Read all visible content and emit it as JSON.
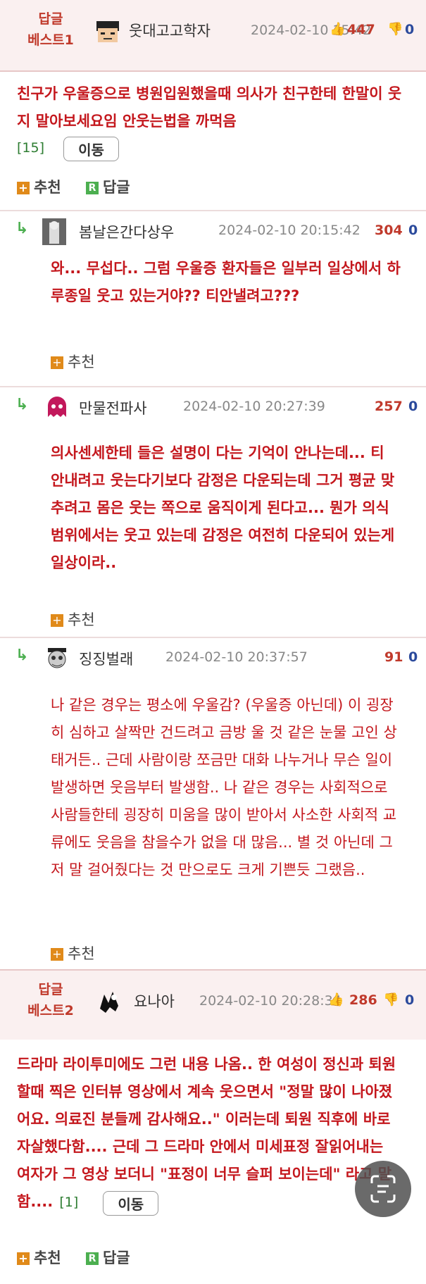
{
  "best1": {
    "label_line1": "답글",
    "label_line2": "베스트1",
    "nick": "웃대고고학자",
    "date": "2024-02-10 15:42",
    "rec": "447",
    "opp": "0",
    "content": "친구가 우울증으로 병원입원했을때 의사가 친구한테 한말이 웃지 말아보세요임 안웃는법을 까먹음",
    "reply_count": "[15]",
    "move_label": "이동",
    "rec_label": "추천",
    "reply_label": "답글"
  },
  "replies": [
    {
      "nick": "봄날은간다상우",
      "date": "2024-02-10 20:15:42",
      "rec": "304",
      "opp": "0",
      "content": "와... 무섭다.. 그럼 우울증 환자들은 일부러 일상에서 하루종일 웃고 있는거야?? 티안낼려고???",
      "rec_label": "추천"
    },
    {
      "nick": "만물전파사",
      "date": "2024-02-10 20:27:39",
      "rec": "257",
      "opp": "0",
      "content": "의사센세한테 들은 설명이 다는 기억이 안나는데... 티 안내려고 웃는다기보다 감정은 다운되는데 그거 평균 맞추려고 몸은 웃는 쪽으로 움직이게 된다고... 뭔가 의식범위에서는 웃고 있는데 감정은 여전히 다운되어 있는게 일상이라..",
      "rec_label": "추천"
    },
    {
      "nick": "징징벌래",
      "date": "2024-02-10 20:37:57",
      "rec": "91",
      "opp": "0",
      "content": "나 같은 경우는 평소에 우울감? (우울증 아닌데) 이 굉장히 심하고 살짝만 건드려고 금방 울 것 같은 눈물 고인 상태거든.. 근데 사람이랑 쪼금만 대화 나누거나 무슨 일이 발생하면 웃음부터 발생함.. 나 같은 경우는 사회적으로 사람들한테 굉장히 미움을 많이 받아서 사소한 사회적 교류에도 웃음을 참을수가 없을 대 많음... 별 것 아닌데 그저 말 걸어줬다는 것 만으로도 크게 기쁜듯 그랬음..",
      "rec_label": "추천"
    }
  ],
  "best2": {
    "label_line1": "답글",
    "label_line2": "베스트2",
    "nick": "요나아",
    "date": "2024-02-10 20:28:34",
    "rec": "286",
    "opp": "0",
    "content": "드라마 라이투미에도 그런 내용 나옴.. 한 여성이 정신과 퇴원할때 찍은 인터뷰 영상에서 계속 웃으면서 \"정말 많이 나아졌어요. 의료진 분들께 감사해요..\" 이러는데 퇴원 직후에 바로 자살했다함.... 근데 그 드라마 안에서 미세표정 잘읽어내는 여자가 그 영상 보더니 \"표정이 너무 슬퍼 보이는데\" 라고 말함....",
    "reply_count": "[1]",
    "move_label": "이동",
    "rec_label": "추천",
    "reply_label": "답글"
  },
  "colors": {
    "best_red": "#c4171d",
    "accent_green": "#4caf50",
    "rec_orange": "#e08a1a"
  }
}
